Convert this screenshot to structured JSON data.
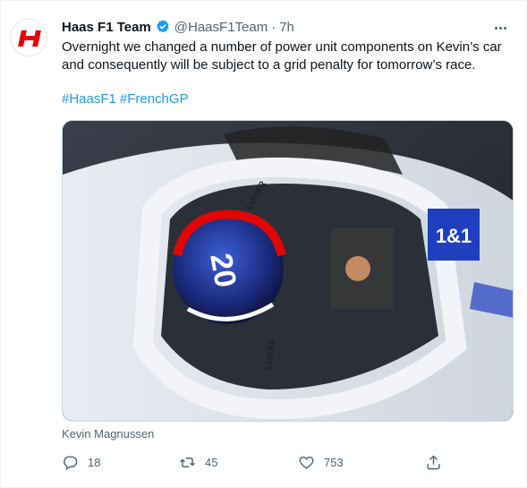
{
  "tweet": {
    "author_name": "Haas F1 Team",
    "handle": "@HaasF1Team",
    "separator": "·",
    "time": "7h",
    "text": "Overnight we changed a number of power unit components on Kevin’s car and consequently will be subject to a grid penalty for tomorrow’s race.",
    "hashtags": [
      "#HaasF1",
      "#FrenchGP"
    ],
    "media_caption": "Kevin Magnussen",
    "media_labels": {
      "car_number": "20",
      "sponsor": "1&1",
      "halo_text_top": "LUNAR",
      "halo_text_bottom": "LUNAR"
    },
    "counts": {
      "replies": "18",
      "retweets": "45",
      "likes": "753"
    }
  },
  "icons": {
    "avatar": "haas-logo-icon",
    "verified": "verified-badge-icon",
    "more": "more-options-icon",
    "reply": "reply-icon",
    "retweet": "retweet-icon",
    "like": "heart-icon",
    "share": "share-icon"
  },
  "colors": {
    "link": "#1d9bf0",
    "secondary": "#536471",
    "brand_red": "#e10600"
  }
}
